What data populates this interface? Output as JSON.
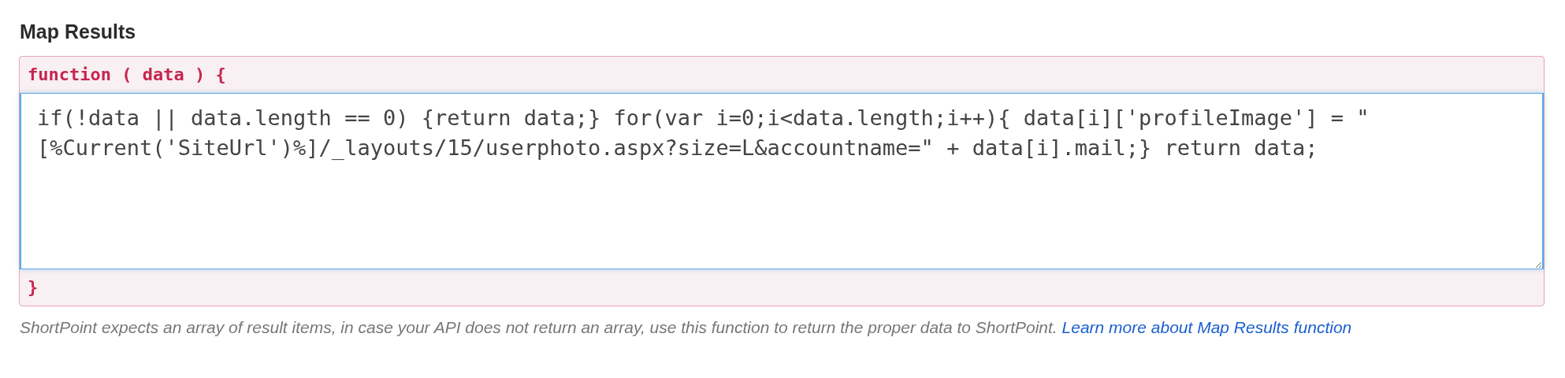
{
  "section": {
    "title": "Map Results"
  },
  "editor": {
    "header": "function ( data ) {",
    "value": "if(!data || data.length == 0) {return data;} for(var i=0;i<data.length;i++){ data[i]['profileImage'] = \"[%Current('SiteUrl')%]/_layouts/15/userphoto.aspx?size=L&accountname=\" + data[i].mail;} return data;",
    "focused": true,
    "footer": "}"
  },
  "help": {
    "text": "ShortPoint expects an array of result items, in case your API does not return an array, use this function to return the proper data to ShortPoint.",
    "link": "Learn more about Map Results function"
  }
}
